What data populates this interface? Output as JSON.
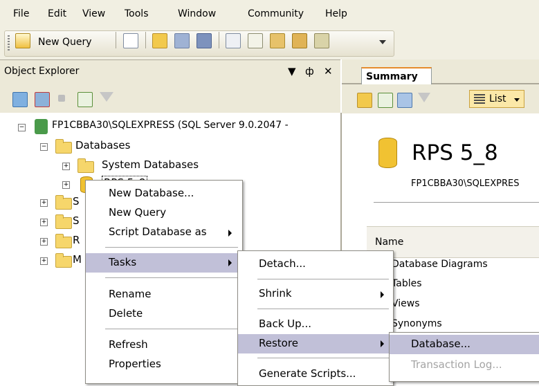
{
  "menubar": [
    "File",
    "Edit",
    "View",
    "Tools",
    "Window",
    "Community",
    "Help"
  ],
  "toolbar": {
    "new_query_label": "New Query"
  },
  "object_explorer": {
    "title": "Object Explorer",
    "pin_glyph": "↓ ॱ ✕",
    "tree": {
      "server": "FP1CBBA30\\SQLEXPRESS (SQL Server 9.0.2047 -",
      "databases": "Databases",
      "system_databases": "System Databases",
      "selected_db": "RPS 5_8",
      "collapsed_initials": [
        "S",
        "S",
        "R",
        "M"
      ]
    }
  },
  "context_menu_db": {
    "items": [
      "New Database...",
      "New Query",
      "Script Database as",
      "Tasks",
      "Rename",
      "Delete",
      "Refresh",
      "Properties"
    ]
  },
  "tasks_submenu": {
    "items": [
      "Detach...",
      "Shrink",
      "Back Up...",
      "Restore",
      "Generate Scripts..."
    ]
  },
  "restore_submenu": {
    "items": [
      "Database...",
      "Transaction Log..."
    ]
  },
  "summary": {
    "tab_label": "Summary",
    "list_label": "List",
    "db_name": "RPS 5_8",
    "db_path": "FP1CBBA30\\SQLEXPRES",
    "column_header": "Name",
    "items": [
      "Database Diagrams",
      "Tables",
      "Views",
      "Synonyms"
    ]
  },
  "icons": [
    "new-query-icon",
    "new-file-icon",
    "open-folder-icon",
    "save-icon",
    "save-all-icon",
    "copy-icon",
    "properties-icon",
    "connect-icon",
    "disconnect-icon",
    "stop-icon",
    "refresh-icon",
    "filter-icon",
    "database-icon",
    "folder-icon",
    "server-icon",
    "list-view-icon"
  ],
  "colors": {
    "chrome": "#ece9d8",
    "menu_highlight": "#c1c0d8",
    "tab_accent": "#e68b2c"
  }
}
